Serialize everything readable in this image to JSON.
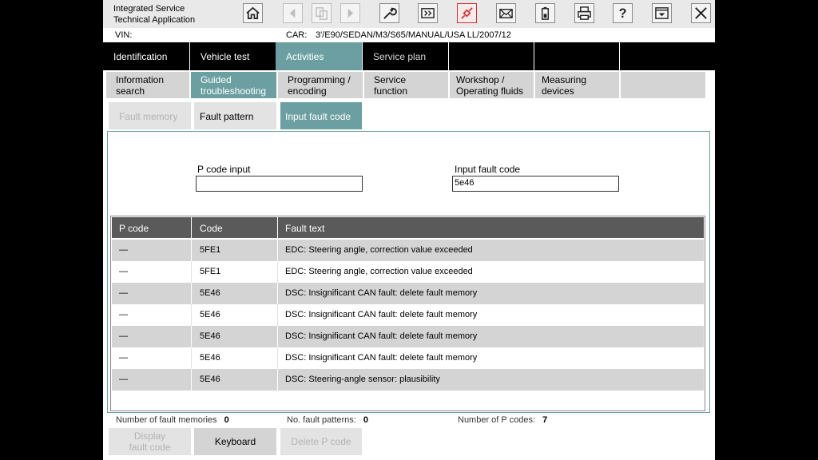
{
  "app": {
    "title_line1": "Integrated Service",
    "title_line2": "Technical Application"
  },
  "toolbar": {
    "icons": [
      "home-icon",
      "back-icon",
      "copy-icon",
      "forward-icon",
      "wrench-icon",
      "battery-bay-icon",
      "connector-icon",
      "mail-icon",
      "battery-icon",
      "printer-icon",
      "help-icon",
      "window-dropdown-icon",
      "close-icon"
    ]
  },
  "info": {
    "vin_label": "VIN:",
    "car_label": "CAR:",
    "car_value": "3'/E90/SEDAN/M3/S65/MANUAL/USA LL/2007/12"
  },
  "main_tabs": [
    {
      "label": "Identification"
    },
    {
      "label": "Vehicle test"
    },
    {
      "label": "Activities"
    },
    {
      "label": "Service plan"
    }
  ],
  "sub_tabs": [
    {
      "line1": "Information",
      "line2": "search"
    },
    {
      "line1": "Guided",
      "line2": "troubleshooting"
    },
    {
      "line1": "Programming /",
      "line2": "encoding"
    },
    {
      "line1": "Service",
      "line2": "function"
    },
    {
      "line1": "Workshop /",
      "line2": "Operating fluids"
    },
    {
      "line1": "Measuring",
      "line2": "devices"
    }
  ],
  "function_tabs": [
    {
      "label": "Fault memory"
    },
    {
      "label": "Fault pattern"
    },
    {
      "label": "Input fault code"
    }
  ],
  "form": {
    "pcode_label": "P code input",
    "pcode_value": "",
    "faultcode_label": "Input fault code",
    "faultcode_value": "5e46"
  },
  "table": {
    "headers": [
      "P code",
      "Code",
      "Fault text"
    ],
    "rows": [
      {
        "pcode": "—",
        "code": "5FE1",
        "text": "EDC: Steering angle, correction value exceeded"
      },
      {
        "pcode": "—",
        "code": "5FE1",
        "text": "EDC: Steering angle, correction value exceeded"
      },
      {
        "pcode": "—",
        "code": "5E46",
        "text": "DSC: Insignificant CAN fault: delete fault memory"
      },
      {
        "pcode": "—",
        "code": "5E46",
        "text": "DSC: Insignificant CAN fault: delete fault memory"
      },
      {
        "pcode": "—",
        "code": "5E46",
        "text": "DSC: Insignificant CAN fault: delete fault memory"
      },
      {
        "pcode": "—",
        "code": "5E46",
        "text": "DSC: Insignificant CAN fault: delete fault memory"
      },
      {
        "pcode": "—",
        "code": "5E46",
        "text": "DSC: Steering-angle sensor: plausibility"
      }
    ]
  },
  "status": {
    "fault_memories_label": "Number of fault memories",
    "fault_memories_value": "0",
    "fault_patterns_label": "No. fault patterns:",
    "fault_patterns_value": "0",
    "pcodes_label": "Number of P codes:",
    "pcodes_value": "7"
  },
  "buttons": {
    "display_line1": "Display",
    "display_line2": "fault code",
    "keyboard": "Keyboard",
    "delete_pcode": "Delete P code"
  },
  "colors": {
    "accent": "#6c9fa1",
    "header_dark": "#5a5a5a",
    "row_alt": "#d4d4d4"
  }
}
